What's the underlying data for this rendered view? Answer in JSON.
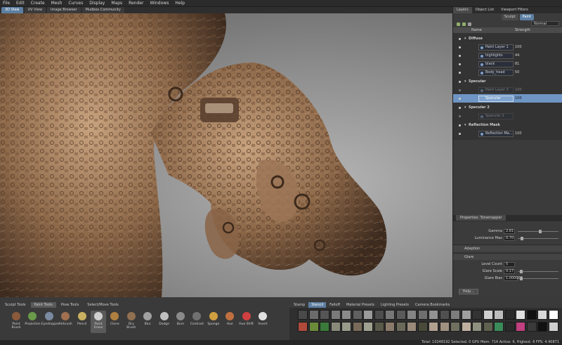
{
  "menu": [
    "File",
    "Edit",
    "Create",
    "Mesh",
    "Curves",
    "Display",
    "Maps",
    "Render",
    "Windows",
    "Help"
  ],
  "viewport_tabs": [
    {
      "label": "3D View",
      "active": true
    },
    {
      "label": "UV View",
      "active": false
    },
    {
      "label": "Image Browser",
      "active": false
    },
    {
      "label": "Mudbox Community",
      "active": false
    }
  ],
  "right_tabs": [
    {
      "label": "Layers",
      "active": true
    },
    {
      "label": "Object List",
      "active": false
    },
    {
      "label": "Viewport Filters",
      "active": false
    }
  ],
  "mode_toggles": [
    {
      "label": "Sculpt",
      "active": false
    },
    {
      "label": "Paint",
      "active": true
    }
  ],
  "blend_mode": "Normal",
  "layer_columns": {
    "name": "Name",
    "strength": "Strength"
  },
  "layer_groups": [
    {
      "name": "Diffuse",
      "layers": [
        {
          "name": "Paint Layer 1",
          "value": "100",
          "state": "normal"
        },
        {
          "name": "highlights",
          "value": "44",
          "state": "normal"
        },
        {
          "name": "black",
          "value": "81",
          "state": "normal"
        },
        {
          "name": "Body_head",
          "value": "50",
          "state": "normal"
        }
      ]
    },
    {
      "name": "Specular",
      "layers": [
        {
          "name": "Paint Layer 3",
          "value": "100",
          "state": "dim"
        },
        {
          "name": "Specular",
          "value": "100",
          "state": "selected"
        }
      ]
    },
    {
      "name": "Specular 2",
      "layers": [
        {
          "name": "Specular 2",
          "value": "",
          "state": "dim"
        }
      ]
    },
    {
      "name": "Reflection Mask",
      "layers": [
        {
          "name": "Reflection Ma...",
          "value": "100",
          "state": "normal"
        }
      ]
    }
  ],
  "properties": {
    "tab": "Properties: Tonemapper",
    "gamma": {
      "label": "Gamma",
      "value": "2.81",
      "fraction": 0.56
    },
    "luminance_max": {
      "label": "Luminance Max",
      "value": "0.70",
      "fraction": 0.07
    },
    "adaption": "Adaption",
    "glare": "Glare",
    "level_count": {
      "label": "Level Count",
      "value": "5"
    },
    "glare_scale": {
      "label": "Glare Scale",
      "value": "0.17",
      "fraction": 0.05
    },
    "glare_bias": {
      "label": "Glare Bias",
      "value": "1.000000",
      "fraction": 0.05
    },
    "help": "Help..."
  },
  "tool_tabs": [
    {
      "label": "Sculpt Tools",
      "active": false
    },
    {
      "label": "Paint Tools",
      "active": true
    },
    {
      "label": "Pose Tools",
      "active": false
    },
    {
      "label": "Select/Move Tools",
      "active": false
    }
  ],
  "tools": [
    {
      "label": "Paint Brush",
      "color": "#8a5a3a"
    },
    {
      "label": "Projection",
      "color": "#6a9a4a"
    },
    {
      "label": "Eyedropper",
      "color": "#7a8aa0"
    },
    {
      "label": "Airbrush",
      "color": "#a07050"
    },
    {
      "label": "Pencil",
      "color": "#c8b060"
    },
    {
      "label": "Paint Erase",
      "color": "#d0d0d0"
    },
    {
      "label": "Clone",
      "color": "#b08040"
    },
    {
      "label": "Dry Brush",
      "color": "#907050"
    },
    {
      "label": "Blur",
      "color": "#a0a0a0"
    },
    {
      "label": "Dodge",
      "color": "#c0c0c0"
    },
    {
      "label": "Burn",
      "color": "#8a8a8a"
    },
    {
      "label": "Contrast",
      "color": "#707070"
    },
    {
      "label": "Sponge",
      "color": "#d0a040"
    },
    {
      "label": "Hue",
      "color": "#c07040"
    },
    {
      "label": "Hue Shift",
      "color": "#d04040"
    },
    {
      "label": "Invert",
      "color": "#e0e0e0"
    }
  ],
  "stamp_tabs": [
    {
      "label": "Stamp",
      "active": false
    },
    {
      "label": "Stencil",
      "active": true
    },
    {
      "label": "Falloff",
      "active": false
    },
    {
      "label": "Material Presets",
      "active": false
    },
    {
      "label": "Lighting Presets",
      "active": false
    },
    {
      "label": "Camera Bookmarks",
      "active": false
    }
  ],
  "stamp_colors": [
    "#4a4a4a",
    "#6b6b6b",
    "#555",
    "#7a7a7a",
    "#8a8a8a",
    "#606060",
    "#9a9a9a",
    "#4d4d4d",
    "#777",
    "#5a5a5a",
    "#858585",
    "#6f6f6f",
    "#929292",
    "#505050",
    "#7d7d7d",
    "#a0a0a0",
    "#333",
    "#cfcfcf",
    "#bdbdbd",
    "#2a2a2a",
    "#e0e0e0",
    "#111",
    "#d8d8d8",
    "#ffffff",
    "#b04a3a",
    "#6a8a3a",
    "#3a7a3a",
    "#8a8a7a",
    "#9a9a8a",
    "#7a6a5a",
    "#a0a090",
    "#5a5a4a",
    "#8a7a6a",
    "#6a6a5a",
    "#9a8a7a",
    "#4a4a3a",
    "#b0a090",
    "#a09080",
    "#707060",
    "#c0b0a0",
    "#909080",
    "#606050",
    "#3a8a5a",
    "#2a2a2a",
    "#c04080",
    "#3a3a3a",
    "#111",
    "#d0d0d0"
  ],
  "status": "Total: 10248192  Selected: 0  GPU Mem: 714  Active: 6, Highest: 6  FPS: 4.40871"
}
